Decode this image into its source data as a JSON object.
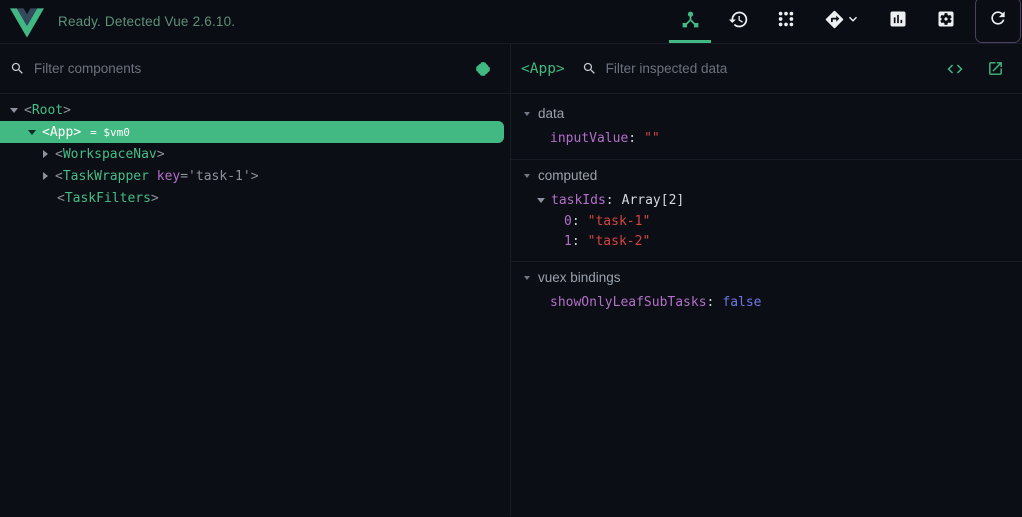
{
  "syntax": {
    "lt": "<",
    "gt": ">"
  },
  "topbar": {
    "status_text": "Ready. Detected Vue 2.6.10.",
    "logo_icon": "vue-logo",
    "tabs": [
      {
        "id": "components",
        "icon": "components-tree-icon",
        "active": true
      },
      {
        "id": "vuex",
        "icon": "history-clock-icon",
        "active": false
      },
      {
        "id": "events",
        "icon": "dots-grain-icon",
        "active": false
      },
      {
        "id": "routing",
        "icon": "routing-diamond-icon",
        "dropdown_icon": "chevron-down-icon",
        "active": false
      },
      {
        "id": "performance",
        "icon": "bar-chart-icon",
        "active": false
      },
      {
        "id": "settings",
        "icon": "gear-icon",
        "active": false
      }
    ],
    "refresh_icon": "refresh-icon"
  },
  "left_panel": {
    "search_icon": "search-icon",
    "filter_placeholder": "Filter components",
    "select_component_icon": "target-crosshair-icon",
    "tree": [
      {
        "tag": "Root",
        "state": "expanded",
        "depth": 0
      },
      {
        "tag": "App",
        "suffix": "= $vm0",
        "state": "expanded",
        "selected": true,
        "depth": 1
      },
      {
        "tag": "WorkspaceNav",
        "state": "collapsed",
        "depth": 2
      },
      {
        "tag": "TaskWrapper",
        "attr_name": "key",
        "attr_rest": "='task-1'",
        "state": "collapsed",
        "depth": 2
      },
      {
        "tag": "TaskFilters",
        "state": "leaf",
        "depth": 2
      }
    ]
  },
  "right_panel": {
    "title": "<App>",
    "search_icon": "search-icon",
    "filter_placeholder": "Filter inspected data",
    "toolbar_icons": [
      "inspect-dom-icon",
      "open-in-editor-icon"
    ],
    "sections": [
      {
        "name": "data",
        "fields": [
          {
            "key": "inputValue",
            "value": "\"\"",
            "type": "string"
          }
        ]
      },
      {
        "name": "computed",
        "fields": [
          {
            "key": "taskIds",
            "value": "Array[2]",
            "type": "array",
            "expanded": true,
            "children": [
              {
                "key": "0",
                "value": "\"task-1\"",
                "type": "string"
              },
              {
                "key": "1",
                "value": "\"task-2\"",
                "type": "string"
              }
            ]
          }
        ]
      },
      {
        "name": "vuex bindings",
        "fields": [
          {
            "key": "showOnlyLeafSubTasks",
            "value": "false",
            "type": "boolean"
          }
        ]
      }
    ]
  },
  "colors": {
    "accent_green": "#42b983",
    "status_text_green": "#5d9179",
    "selected_row_bg": "#42b983",
    "key_purple": "#b36fc9",
    "string_red": "#d64343",
    "boolean_blue": "#7176e4",
    "background": "#0b0e14",
    "refresh_frame_purple": "#4d4162"
  }
}
